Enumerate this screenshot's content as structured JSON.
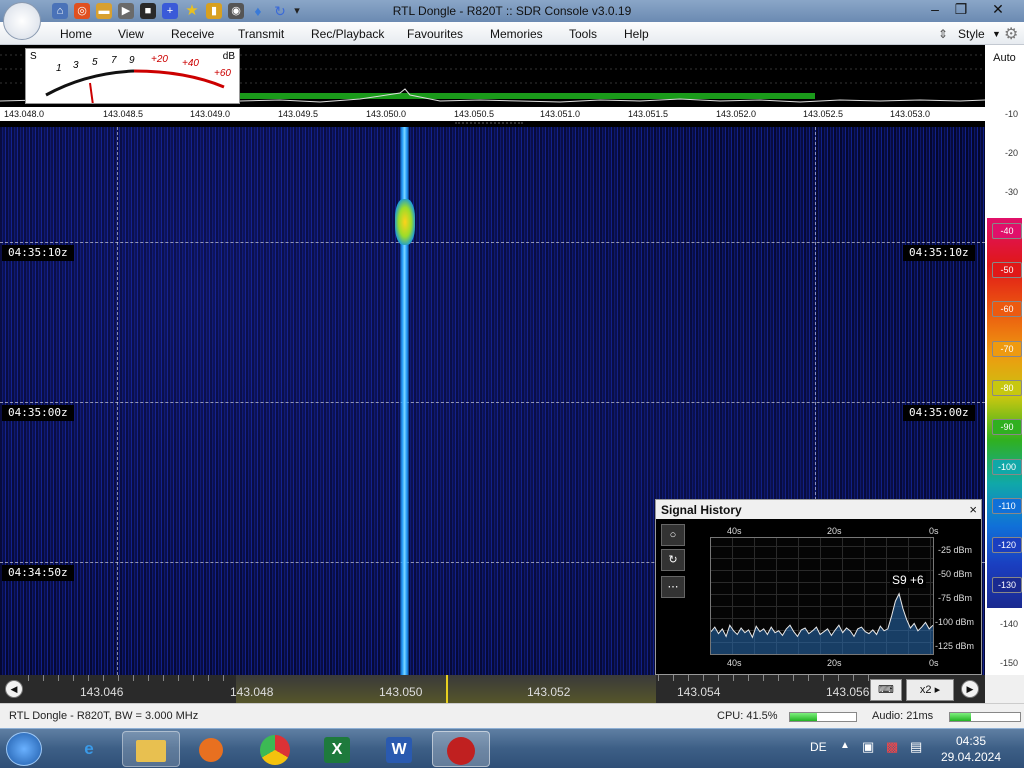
{
  "window": {
    "title": "RTL Dongle - R820T :: SDR Console v3.0.19"
  },
  "menu": {
    "items": [
      "Home",
      "View",
      "Receive",
      "Transmit",
      "Rec/Playback",
      "Favourites",
      "Memories",
      "Tools",
      "Help"
    ],
    "style_label": "Style"
  },
  "smeter": {
    "s_label": "S",
    "db_label": "dB",
    "s_ticks": [
      "1",
      "3",
      "5",
      "7",
      "9"
    ],
    "plus_ticks": [
      "+20",
      "+40",
      "+60"
    ]
  },
  "spectrum": {
    "freq_labels": [
      "143.048.0",
      "143.048.5",
      "143.049.0",
      "143.049.5",
      "143.050.0",
      "143.050.5",
      "143.051.0",
      "143.051.5",
      "143.052.0",
      "143.052.5",
      "143.053.0"
    ]
  },
  "db_scale": {
    "auto_label": "Auto",
    "plain": [
      "-10",
      "-20",
      "-30"
    ],
    "colored": [
      {
        "label": "-40",
        "color": "#e0106a"
      },
      {
        "label": "-50",
        "color": "#e01818"
      },
      {
        "label": "-60",
        "color": "#ec5a10"
      },
      {
        "label": "-70",
        "color": "#ee9a10"
      },
      {
        "label": "-80",
        "color": "#c7c710"
      },
      {
        "label": "-90",
        "color": "#30b020"
      },
      {
        "label": "-100",
        "color": "#10a8a8"
      },
      {
        "label": "-110",
        "color": "#1070d8"
      },
      {
        "label": "-120",
        "color": "#1a3ec0"
      },
      {
        "label": "-130",
        "color": "#1a2a90"
      }
    ],
    "lower": [
      "-140",
      "-150"
    ]
  },
  "waterfall": {
    "timestamps": [
      "04:35:10z",
      "04:35:00z",
      "04:34:50z"
    ]
  },
  "signal_history": {
    "title": "Signal History",
    "close_label": "×",
    "top_ticks": [
      "40s",
      "20s",
      "0s"
    ],
    "bottom_ticks": [
      "40s",
      "20s",
      "0s"
    ],
    "dbm_labels": [
      "-25 dBm",
      "-50 dBm",
      "-75 dBm",
      "-100 dBm",
      "-125 dBm"
    ],
    "s_reading": "S9 +6",
    "button_labels": [
      "○",
      "↻",
      "⋯"
    ],
    "history_dbm": [
      -113,
      -108,
      -115,
      -110,
      -118,
      -106,
      -112,
      -116,
      -109,
      -114,
      -111,
      -119,
      -107,
      -113,
      -110,
      -116,
      -108,
      -114,
      -112,
      -117,
      -110,
      -106,
      -113,
      -118,
      -111,
      -109,
      -115,
      -112,
      -108,
      -116,
      -113,
      -110,
      -117,
      -111,
      -106,
      -114,
      -109,
      -112,
      -118,
      -110,
      -108,
      -113,
      -115,
      -111,
      -116,
      -107,
      -112,
      -110,
      -96,
      -80,
      -72,
      -88,
      -100,
      -109,
      -104,
      -112,
      -108,
      -103,
      -110,
      -106
    ]
  },
  "bottom_freq": {
    "labels": [
      "143.046",
      "143.048",
      "143.050",
      "143.052",
      "143.054",
      "143.056"
    ],
    "zoom_label": "x2"
  },
  "status": {
    "device": "RTL Dongle - R820T, BW = 3.000 MHz",
    "cpu_label": "CPU: 41.5%",
    "cpu_percent": 41.5,
    "audio_label": "Audio: 21ms",
    "audio_level": 0.3
  },
  "taskbar": {
    "language": "DE",
    "time": "04:35",
    "date": "29.04.2024"
  },
  "colors": {
    "accent": "#6b8ab2",
    "waterfall_bg": "#050a3a",
    "carrier": "#2ea8ff"
  }
}
